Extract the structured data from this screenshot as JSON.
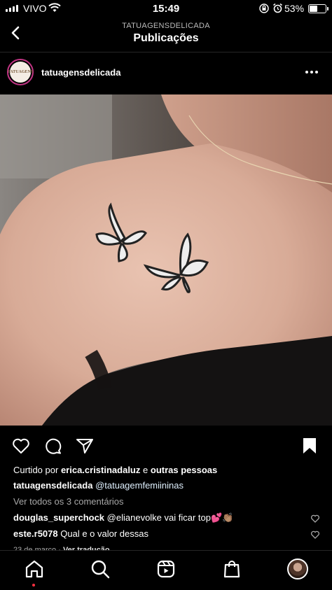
{
  "status_bar": {
    "carrier": "VIVO",
    "time": "15:49",
    "battery_percent": "53%",
    "battery_level": 0.53,
    "icons": [
      "signal-icon",
      "wifi-icon",
      "orientation-lock-icon",
      "alarm-icon",
      "battery-icon"
    ]
  },
  "header": {
    "subtitle": "TATUAGENSDELICADA",
    "title": "Publicações",
    "back_icon": "chevron-left-icon"
  },
  "post": {
    "avatar_text": "TATUAGENS",
    "username": "tatuagensdelicada",
    "more_icon": "more-horizontal-icon",
    "image_alt": "Butterfly tattoos on shoulder",
    "actions": [
      "heart-icon",
      "comment-icon",
      "share-icon",
      "bookmark-icon"
    ],
    "liked_by_prefix": "Curtido por",
    "liked_by_user": "erica.cristinadaluz",
    "liked_by_conj": "e",
    "liked_by_rest": "outras pessoas",
    "caption_user": "tatuagensdelicada",
    "caption_text": "@tatuagemfemiininas",
    "view_comments": "Ver todos os 3 comentários",
    "comments": [
      {
        "user": "douglas_superchock",
        "text": "@elianevolke vai ficar top💕👏🏽"
      },
      {
        "user": "este.r5078",
        "text": "Qual e o valor dessas"
      }
    ],
    "date": "23 de março",
    "see_translation": "Ver tradução"
  },
  "nav": {
    "items": [
      "home-icon",
      "search-icon",
      "reels-icon",
      "shop-icon",
      "profile-avatar"
    ]
  },
  "colors": {
    "background": "#000000",
    "text": "#ffffff",
    "secondary_text": "#a8a8a8",
    "story_ring": "#c13584",
    "notification_dot": "#ff3040"
  }
}
